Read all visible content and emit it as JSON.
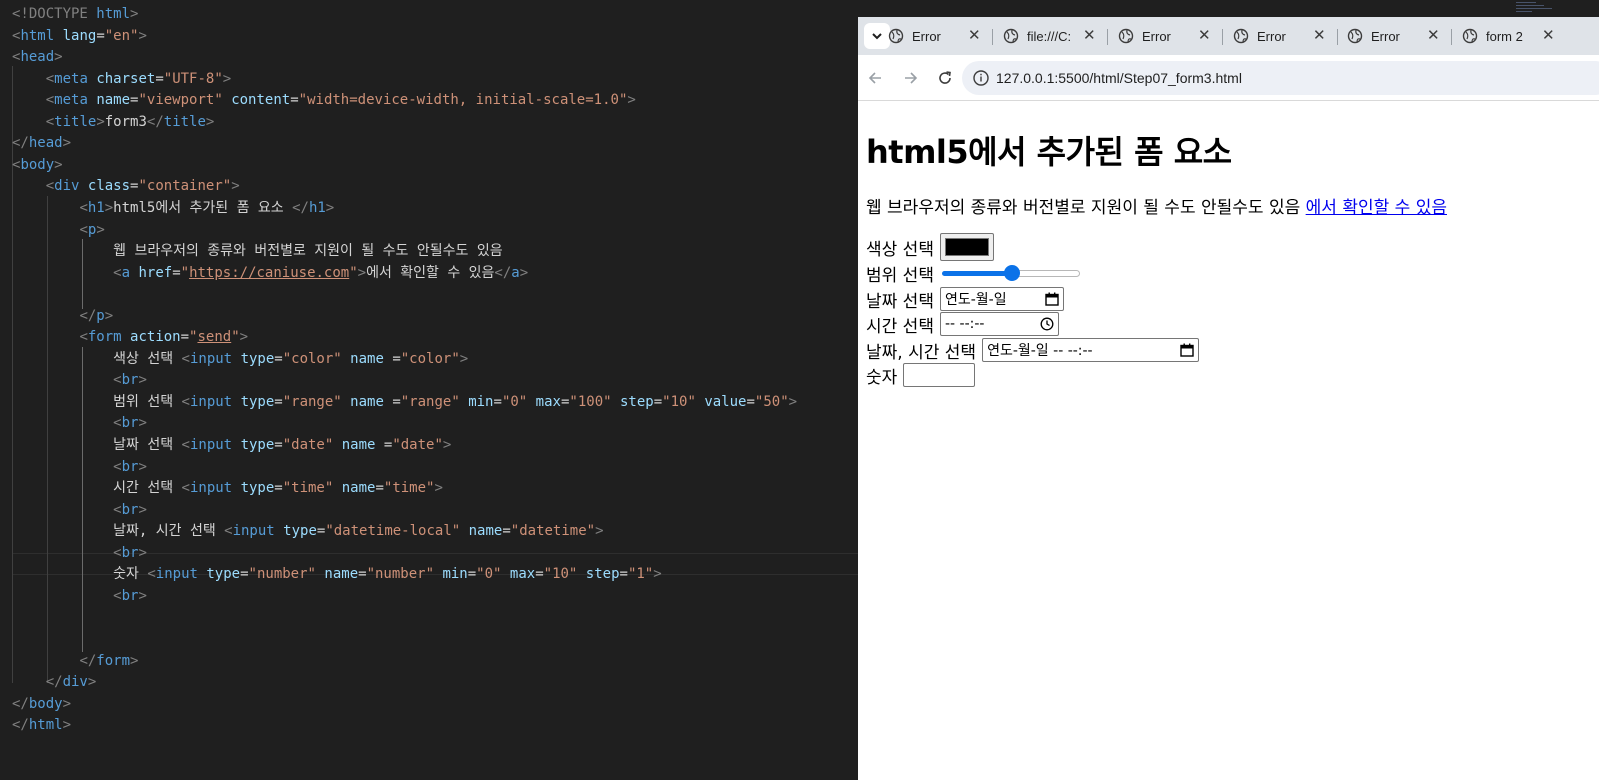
{
  "editor": {
    "lines": [
      [
        [
          "t-gray",
          "<!DOCTYPE "
        ],
        [
          "t-tag",
          "html"
        ],
        [
          "t-gray",
          ">"
        ]
      ],
      [
        [
          "t-gray",
          "<"
        ],
        [
          "t-tag",
          "html"
        ],
        [
          "t-text",
          " "
        ],
        [
          "t-attr",
          "lang"
        ],
        [
          "t-text",
          "="
        ],
        [
          "t-val",
          "\"en\""
        ],
        [
          "t-gray",
          ">"
        ]
      ],
      [
        [
          "t-gray",
          "<"
        ],
        [
          "t-tag",
          "head"
        ],
        [
          "t-gray",
          ">"
        ]
      ],
      [
        [
          "t-text",
          "    "
        ],
        [
          "t-gray",
          "<"
        ],
        [
          "t-tag",
          "meta"
        ],
        [
          "t-text",
          " "
        ],
        [
          "t-attr",
          "charset"
        ],
        [
          "t-text",
          "="
        ],
        [
          "t-val",
          "\"UTF-8\""
        ],
        [
          "t-gray",
          ">"
        ]
      ],
      [
        [
          "t-text",
          "    "
        ],
        [
          "t-gray",
          "<"
        ],
        [
          "t-tag",
          "meta"
        ],
        [
          "t-text",
          " "
        ],
        [
          "t-attr",
          "name"
        ],
        [
          "t-text",
          "="
        ],
        [
          "t-val",
          "\"viewport\""
        ],
        [
          "t-text",
          " "
        ],
        [
          "t-attr",
          "content"
        ],
        [
          "t-text",
          "="
        ],
        [
          "t-val",
          "\"width=device-width, initial-scale=1.0\""
        ],
        [
          "t-gray",
          ">"
        ]
      ],
      [
        [
          "t-text",
          "    "
        ],
        [
          "t-gray",
          "<"
        ],
        [
          "t-tag",
          "title"
        ],
        [
          "t-gray",
          ">"
        ],
        [
          "t-text",
          "form3"
        ],
        [
          "t-gray",
          "</"
        ],
        [
          "t-tag",
          "title"
        ],
        [
          "t-gray",
          ">"
        ]
      ],
      [
        [
          "t-gray",
          "</"
        ],
        [
          "t-tag",
          "head"
        ],
        [
          "t-gray",
          ">"
        ]
      ],
      [
        [
          "t-gray",
          "<"
        ],
        [
          "t-tag",
          "body"
        ],
        [
          "t-gray",
          ">"
        ]
      ],
      [
        [
          "t-text",
          "    "
        ],
        [
          "t-gray",
          "<"
        ],
        [
          "t-tag",
          "div"
        ],
        [
          "t-text",
          " "
        ],
        [
          "t-attr",
          "class"
        ],
        [
          "t-text",
          "="
        ],
        [
          "t-val",
          "\"container\""
        ],
        [
          "t-gray",
          ">"
        ]
      ],
      [
        [
          "t-text",
          "        "
        ],
        [
          "t-gray",
          "<"
        ],
        [
          "t-tag",
          "h1"
        ],
        [
          "t-gray",
          ">"
        ],
        [
          "t-text",
          "html5에서 추가된 폼 요소 "
        ],
        [
          "t-gray",
          "</"
        ],
        [
          "t-tag",
          "h1"
        ],
        [
          "t-gray",
          ">"
        ]
      ],
      [
        [
          "t-text",
          "        "
        ],
        [
          "t-gray",
          "<"
        ],
        [
          "t-tag",
          "p"
        ],
        [
          "t-gray",
          ">"
        ]
      ],
      [
        [
          "t-text",
          "            웹 브라우저의 종류와 버전별로 지원이 될 수도 안될수도 있음"
        ]
      ],
      [
        [
          "t-text",
          "            "
        ],
        [
          "t-gray",
          "<"
        ],
        [
          "t-tag",
          "a"
        ],
        [
          "t-text",
          " "
        ],
        [
          "t-attr",
          "href"
        ],
        [
          "t-text",
          "="
        ],
        [
          "t-val",
          "\""
        ],
        [
          "t-link",
          "https://caniuse.com"
        ],
        [
          "t-val",
          "\""
        ],
        [
          "t-gray",
          ">"
        ],
        [
          "t-text",
          "에서 확인할 수 있음"
        ],
        [
          "t-gray",
          "</"
        ],
        [
          "t-tag",
          "a"
        ],
        [
          "t-gray",
          ">"
        ]
      ],
      [
        [
          "t-text",
          ""
        ]
      ],
      [
        [
          "t-text",
          "        "
        ],
        [
          "t-gray",
          "</"
        ],
        [
          "t-tag",
          "p"
        ],
        [
          "t-gray",
          ">"
        ]
      ],
      [
        [
          "t-text",
          "        "
        ],
        [
          "t-gray",
          "<"
        ],
        [
          "t-tag",
          "form"
        ],
        [
          "t-text",
          " "
        ],
        [
          "t-attr",
          "action"
        ],
        [
          "t-text",
          "="
        ],
        [
          "t-val",
          "\""
        ],
        [
          "t-link",
          "send"
        ],
        [
          "t-val",
          "\""
        ],
        [
          "t-gray",
          ">"
        ]
      ],
      [
        [
          "t-text",
          "            색상 선택 "
        ],
        [
          "t-gray",
          "<"
        ],
        [
          "t-tag",
          "input"
        ],
        [
          "t-text",
          " "
        ],
        [
          "t-attr",
          "type"
        ],
        [
          "t-text",
          "="
        ],
        [
          "t-val",
          "\"color\""
        ],
        [
          "t-text",
          " "
        ],
        [
          "t-attr",
          "name"
        ],
        [
          "t-text",
          " ="
        ],
        [
          "t-val",
          "\"color\""
        ],
        [
          "t-gray",
          ">"
        ]
      ],
      [
        [
          "t-text",
          "            "
        ],
        [
          "t-gray",
          "<"
        ],
        [
          "t-tag",
          "br"
        ],
        [
          "t-gray",
          ">"
        ]
      ],
      [
        [
          "t-text",
          "            범위 선택 "
        ],
        [
          "t-gray",
          "<"
        ],
        [
          "t-tag",
          "input"
        ],
        [
          "t-text",
          " "
        ],
        [
          "t-attr",
          "type"
        ],
        [
          "t-text",
          "="
        ],
        [
          "t-val",
          "\"range\""
        ],
        [
          "t-text",
          " "
        ],
        [
          "t-attr",
          "name"
        ],
        [
          "t-text",
          " ="
        ],
        [
          "t-val",
          "\"range\""
        ],
        [
          "t-text",
          " "
        ],
        [
          "t-attr",
          "min"
        ],
        [
          "t-text",
          "="
        ],
        [
          "t-val",
          "\"0\""
        ],
        [
          "t-text",
          " "
        ],
        [
          "t-attr",
          "max"
        ],
        [
          "t-text",
          "="
        ],
        [
          "t-val",
          "\"100\""
        ],
        [
          "t-text",
          " "
        ],
        [
          "t-attr",
          "step"
        ],
        [
          "t-text",
          "="
        ],
        [
          "t-val",
          "\"10\""
        ],
        [
          "t-text",
          " "
        ],
        [
          "t-attr",
          "value"
        ],
        [
          "t-text",
          "="
        ],
        [
          "t-val",
          "\"50\""
        ],
        [
          "t-gray",
          ">"
        ]
      ],
      [
        [
          "t-text",
          "            "
        ],
        [
          "t-gray",
          "<"
        ],
        [
          "t-tag",
          "br"
        ],
        [
          "t-gray",
          ">"
        ]
      ],
      [
        [
          "t-text",
          "            날짜 선택 "
        ],
        [
          "t-gray",
          "<"
        ],
        [
          "t-tag",
          "input"
        ],
        [
          "t-text",
          " "
        ],
        [
          "t-attr",
          "type"
        ],
        [
          "t-text",
          "="
        ],
        [
          "t-val",
          "\"date\""
        ],
        [
          "t-text",
          " "
        ],
        [
          "t-attr",
          "name"
        ],
        [
          "t-text",
          " ="
        ],
        [
          "t-val",
          "\"date\""
        ],
        [
          "t-gray",
          ">"
        ]
      ],
      [
        [
          "t-text",
          "            "
        ],
        [
          "t-gray",
          "<"
        ],
        [
          "t-tag",
          "br"
        ],
        [
          "t-gray",
          ">"
        ]
      ],
      [
        [
          "t-text",
          "            시간 선택 "
        ],
        [
          "t-gray",
          "<"
        ],
        [
          "t-tag",
          "input"
        ],
        [
          "t-text",
          " "
        ],
        [
          "t-attr",
          "type"
        ],
        [
          "t-text",
          "="
        ],
        [
          "t-val",
          "\"time\""
        ],
        [
          "t-text",
          " "
        ],
        [
          "t-attr",
          "name"
        ],
        [
          "t-text",
          "="
        ],
        [
          "t-val",
          "\"time\""
        ],
        [
          "t-gray",
          ">"
        ]
      ],
      [
        [
          "t-text",
          "            "
        ],
        [
          "t-gray",
          "<"
        ],
        [
          "t-tag",
          "br"
        ],
        [
          "t-gray",
          ">"
        ]
      ],
      [
        [
          "t-text",
          "            날짜, 시간 선택 "
        ],
        [
          "t-gray",
          "<"
        ],
        [
          "t-tag",
          "input"
        ],
        [
          "t-text",
          " "
        ],
        [
          "t-attr",
          "type"
        ],
        [
          "t-text",
          "="
        ],
        [
          "t-val",
          "\"datetime-local\""
        ],
        [
          "t-text",
          " "
        ],
        [
          "t-attr",
          "name"
        ],
        [
          "t-text",
          "="
        ],
        [
          "t-val",
          "\"datetime\""
        ],
        [
          "t-gray",
          ">"
        ]
      ],
      [
        [
          "t-text",
          "            "
        ],
        [
          "t-gray",
          "<"
        ],
        [
          "t-tag",
          "br"
        ],
        [
          "t-gray",
          ">"
        ]
      ],
      [
        [
          "t-text",
          "            숫자 "
        ],
        [
          "t-gray",
          "<"
        ],
        [
          "t-tag",
          "input"
        ],
        [
          "t-text",
          " "
        ],
        [
          "t-attr",
          "type"
        ],
        [
          "t-text",
          "="
        ],
        [
          "t-val",
          "\"number\""
        ],
        [
          "t-text",
          " "
        ],
        [
          "t-attr",
          "name"
        ],
        [
          "t-text",
          "="
        ],
        [
          "t-val",
          "\"number\""
        ],
        [
          "t-text",
          " "
        ],
        [
          "t-attr",
          "min"
        ],
        [
          "t-text",
          "="
        ],
        [
          "t-val",
          "\"0\""
        ],
        [
          "t-text",
          " "
        ],
        [
          "t-attr",
          "max"
        ],
        [
          "t-text",
          "="
        ],
        [
          "t-val",
          "\"10\""
        ],
        [
          "t-text",
          " "
        ],
        [
          "t-attr",
          "step"
        ],
        [
          "t-text",
          "="
        ],
        [
          "t-val",
          "\"1\""
        ],
        [
          "t-gray",
          ">"
        ]
      ],
      [
        [
          "t-text",
          "            "
        ],
        [
          "t-gray",
          "<"
        ],
        [
          "t-tag",
          "br"
        ],
        [
          "t-gray",
          ">"
        ]
      ],
      [
        [
          "t-text",
          ""
        ]
      ],
      [
        [
          "t-text",
          ""
        ]
      ],
      [
        [
          "t-text",
          "        "
        ],
        [
          "t-gray",
          "</"
        ],
        [
          "t-tag",
          "form"
        ],
        [
          "t-gray",
          ">"
        ]
      ],
      [
        [
          "t-text",
          "    "
        ],
        [
          "t-gray",
          "</"
        ],
        [
          "t-tag",
          "div"
        ],
        [
          "t-gray",
          ">"
        ]
      ],
      [
        [
          "t-gray",
          "</"
        ],
        [
          "t-tag",
          "body"
        ],
        [
          "t-gray",
          ">"
        ]
      ],
      [
        [
          "t-gray",
          "</"
        ],
        [
          "t-tag",
          "html"
        ],
        [
          "t-gray",
          ">"
        ]
      ]
    ]
  },
  "browser": {
    "tabs": [
      {
        "title": "Error",
        "close": "✕"
      },
      {
        "title": "file:///C:",
        "close": "✕"
      },
      {
        "title": "Error",
        "close": "✕"
      },
      {
        "title": "Error",
        "close": "✕"
      },
      {
        "title": "Error",
        "close": "✕"
      },
      {
        "title": "form 2",
        "close": "✕"
      }
    ],
    "url": "127.0.0.1:5500/html/Step07_form3.html",
    "page": {
      "heading": "html5에서 추가된 폼 요소",
      "paragraph_text": "웹 브라우저의 종류와 버전별로 지원이 될 수도 안될수도 있음 ",
      "link_text": "에서 확인할 수 있음",
      "color_label": "색상 선택",
      "color_value": "#000000",
      "range_label": "범위 선택",
      "range_value": 50,
      "date_label": "날짜 선택",
      "date_placeholder": "연도-월-일",
      "time_label": "시간 선택",
      "time_placeholder": "-- --:--",
      "datetime_label": "날짜, 시간 선택",
      "datetime_placeholder": "연도-월-일  -- --:--",
      "number_label": "숫자"
    }
  }
}
